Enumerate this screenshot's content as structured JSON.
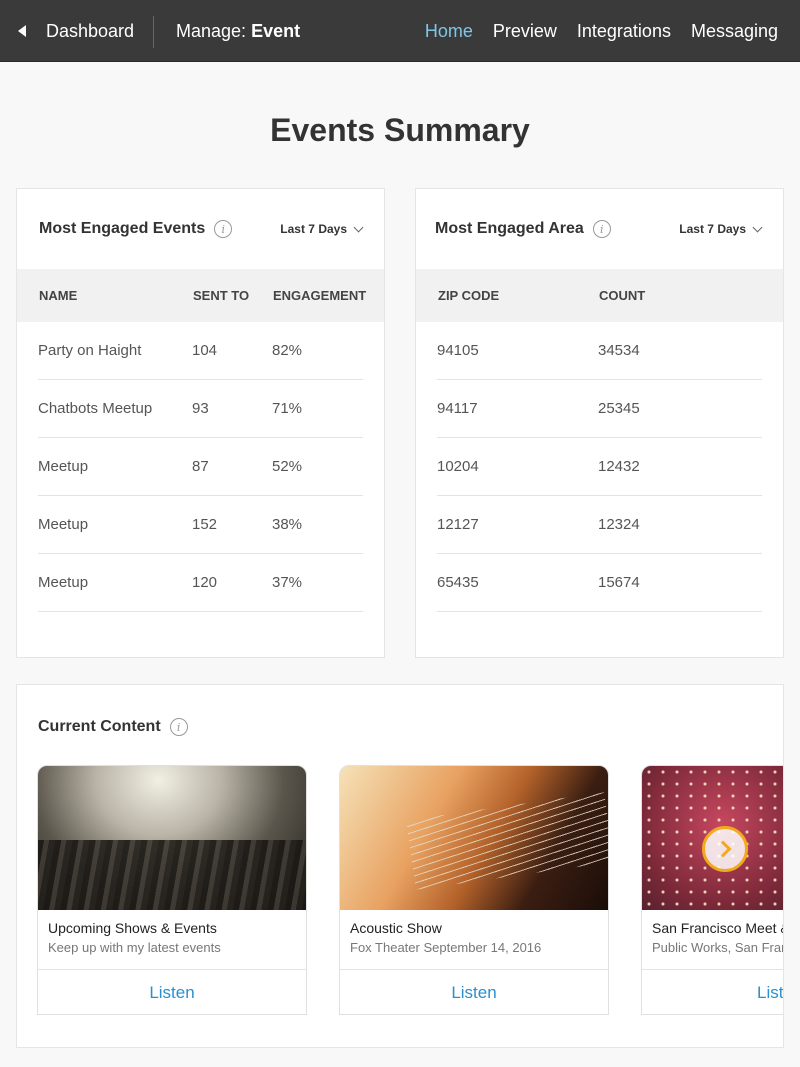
{
  "topbar": {
    "back_label": "Dashboard",
    "manage_prefix": "Manage:",
    "manage_value": "Event",
    "nav": [
      "Home",
      "Preview",
      "Integrations",
      "Messaging"
    ]
  },
  "page_title": "Events Summary",
  "events_card": {
    "title": "Most Engaged Events",
    "range": "Last 7 Days",
    "columns": [
      "NAME",
      "SENT TO",
      "ENGAGEMENT"
    ],
    "rows": [
      [
        "Party on Haight",
        "104",
        "82%"
      ],
      [
        "Chatbots Meetup",
        "93",
        "71%"
      ],
      [
        "Meetup",
        "87",
        "52%"
      ],
      [
        "Meetup",
        "152",
        "38%"
      ],
      [
        "Meetup",
        "120",
        "37%"
      ]
    ]
  },
  "area_card": {
    "title": "Most Engaged Area",
    "range": "Last 7 Days",
    "columns": [
      "ZIP CODE",
      "COUNT"
    ],
    "rows": [
      [
        "94105",
        "34534"
      ],
      [
        "94117",
        "25345"
      ],
      [
        "10204",
        "12432"
      ],
      [
        "12127",
        "12324"
      ],
      [
        "65435",
        "15674"
      ]
    ]
  },
  "content": {
    "title": "Current Content",
    "tiles": [
      {
        "title": "Upcoming Shows & Events",
        "subtitle": "Keep up with my latest events",
        "button": "Listen"
      },
      {
        "title": "Acoustic Show",
        "subtitle": "Fox Theater September 14, 2016",
        "button": "Listen"
      },
      {
        "title": "San Francisco Meet &",
        "subtitle": "Public Works, San Fran",
        "button": "Listen"
      }
    ]
  },
  "colors": {
    "topbar": "#3a3a3a",
    "nav_active": "#7fc6e8",
    "link": "#2a8fd0",
    "carousel_arrow": "#f2a91d"
  }
}
